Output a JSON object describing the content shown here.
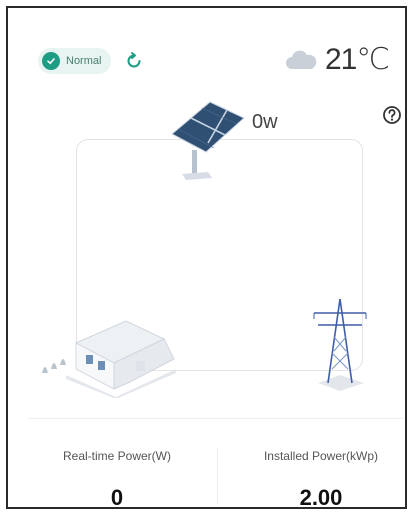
{
  "status": {
    "label": "Normal",
    "icon": "check-circle-icon",
    "color": "#1f9c84"
  },
  "header": {
    "refresh_icon": "refresh-icon",
    "weather_icon": "cloud-icon",
    "temperature": "21℃",
    "help_icon": "help-icon"
  },
  "flow": {
    "pv_power": "0w",
    "illustrations": [
      "solar-panel",
      "house",
      "power-tower"
    ]
  },
  "stats": {
    "realtime": {
      "label": "Real-time Power(W)",
      "value": "0"
    },
    "installed": {
      "label": "Installed Power(kWp)",
      "value": "2.00"
    }
  }
}
